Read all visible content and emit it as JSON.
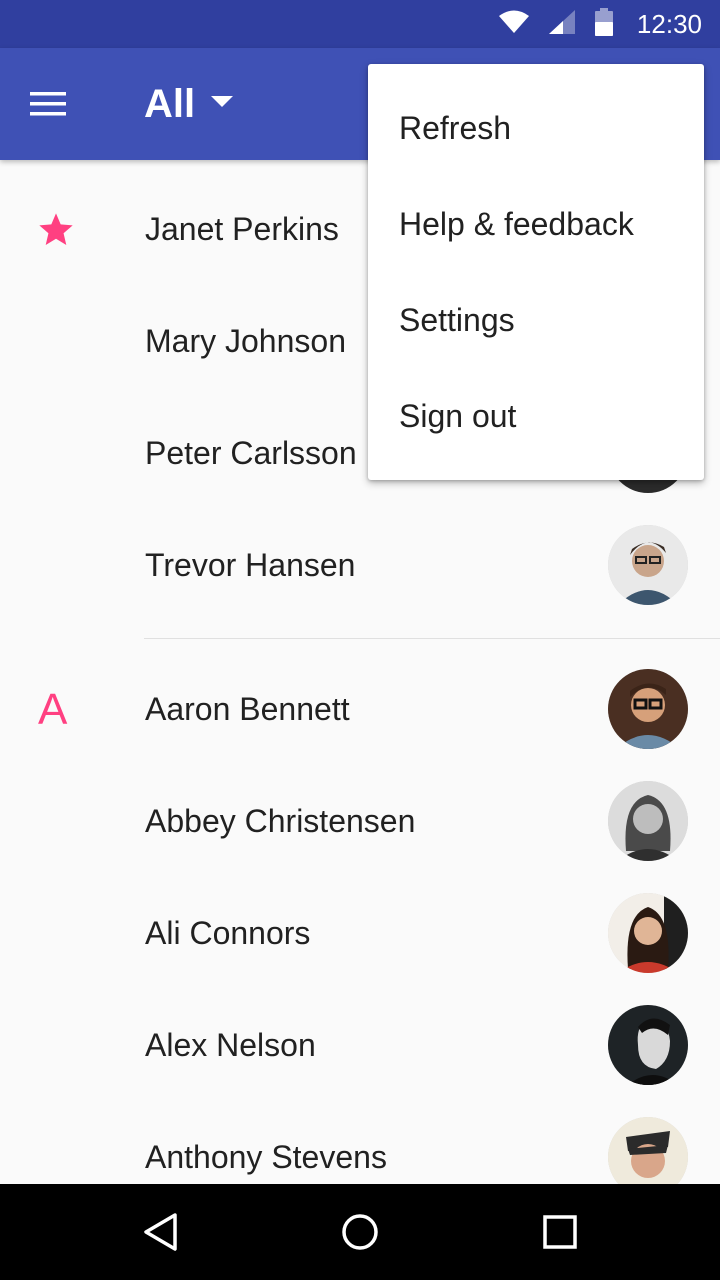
{
  "status_bar": {
    "time": "12:30",
    "icons": [
      "wifi-icon",
      "signal-icon",
      "battery-icon"
    ]
  },
  "toolbar": {
    "title": "All",
    "menu_icon": "hamburger-menu-icon",
    "dropdown_icon": "arrow-drop-down-icon"
  },
  "overflow_menu": {
    "items": [
      {
        "label": "Refresh"
      },
      {
        "label": "Help & feedback"
      },
      {
        "label": "Settings"
      },
      {
        "label": "Sign out"
      }
    ]
  },
  "contacts": {
    "favorites_icon": "star-icon",
    "favorites": [
      {
        "name": "Janet Perkins"
      },
      {
        "name": "Mary Johnson"
      },
      {
        "name": "Peter Carlsson"
      },
      {
        "name": "Trevor Hansen"
      }
    ],
    "section_letter": "A",
    "section_a": [
      {
        "name": "Aaron Bennett"
      },
      {
        "name": "Abbey Christensen"
      },
      {
        "name": "Ali Connors"
      },
      {
        "name": "Alex Nelson"
      },
      {
        "name": "Anthony Stevens"
      }
    ]
  },
  "nav_bar": {
    "icons": [
      "back-icon",
      "home-icon",
      "recents-icon"
    ]
  },
  "colors": {
    "primary": "#3f51b5",
    "primary_dark": "#303f9f",
    "accent": "#ff4081"
  }
}
